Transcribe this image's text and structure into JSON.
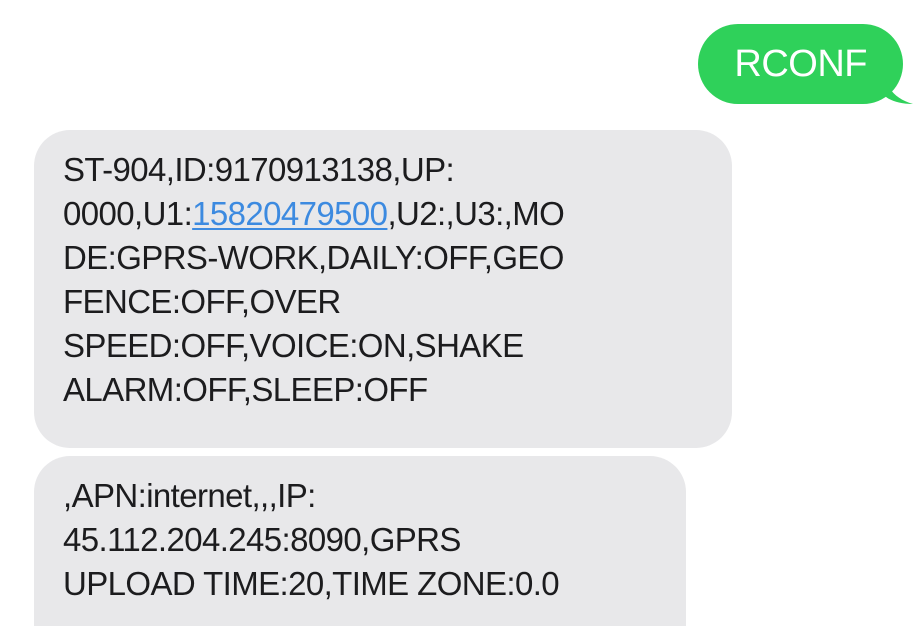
{
  "outgoing": {
    "text": "RCONF",
    "color": "#2fd15a"
  },
  "incoming": [
    {
      "lines": [
        "ST-904,ID:9170913138,UP:",
        {
          "before": "0000,U1:",
          "link": "15820479500",
          "after": ",U2:,U3:,MO"
        },
        "DE:GPRS-WORK,DAILY:OFF,GEO",
        "FENCE:OFF,OVER",
        "SPEED:OFF,VOICE:ON,SHAKE",
        "ALARM:OFF,SLEEP:OFF"
      ]
    },
    {
      "lines": [
        ",APN:internet,,,IP:",
        "45.112.204.245:8090,GPRS",
        "UPLOAD TIME:20,TIME ZONE:0.0"
      ]
    }
  ],
  "colors": {
    "incoming_bubble": "#e8e8ea",
    "link": "#3c8ae0"
  }
}
